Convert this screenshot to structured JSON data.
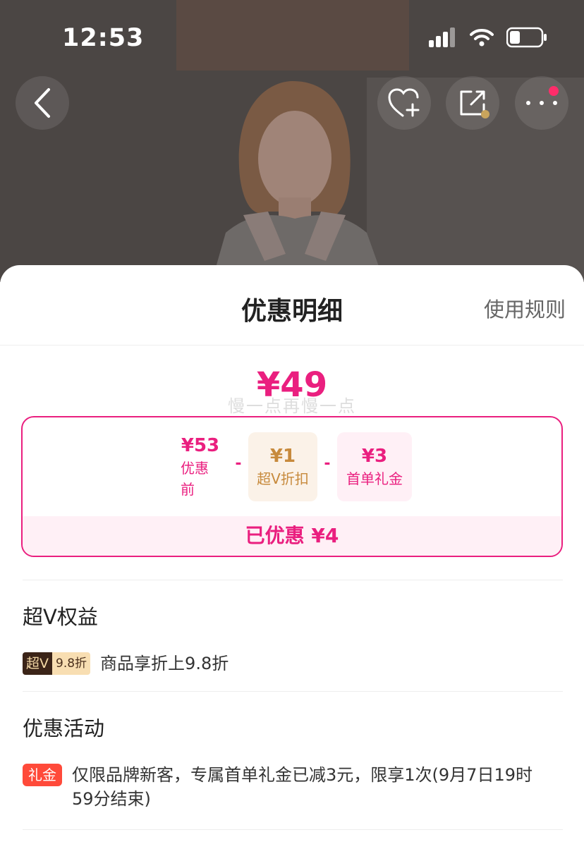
{
  "status_bar": {
    "time": "12:53"
  },
  "nav": {
    "back_icon": "chevron-left-icon",
    "favorite_icon": "heart-plus-icon",
    "share_icon": "share-icon",
    "more_icon": "more-dots-icon"
  },
  "sheet": {
    "title": "优惠明细",
    "rules_link": "使用规则",
    "final_price": "¥49",
    "watermark": "慢一点再慢一点",
    "calc": {
      "before": {
        "amount": "¥53",
        "label": "优惠前"
      },
      "operator_1": "-",
      "vip": {
        "amount": "¥1",
        "label": "超V折扣"
      },
      "operator_2": "-",
      "gift": {
        "amount": "¥3",
        "label": "首单礼金"
      },
      "saved": "已优惠 ¥4"
    },
    "vip_section": {
      "title": "超V权益",
      "tag_left": "超V",
      "tag_right": "9.8折",
      "text": "商品享折上9.8折"
    },
    "promo_section": {
      "title": "优惠活动",
      "tag": "礼金",
      "text": "仅限品牌新客，专属首单礼金已减3元，限享1次(9月7日19时59分结束)"
    }
  },
  "colors": {
    "accent": "#ea1f7f",
    "vip_gold": "#c78a3c",
    "gift_red": "#ff4a3a"
  }
}
